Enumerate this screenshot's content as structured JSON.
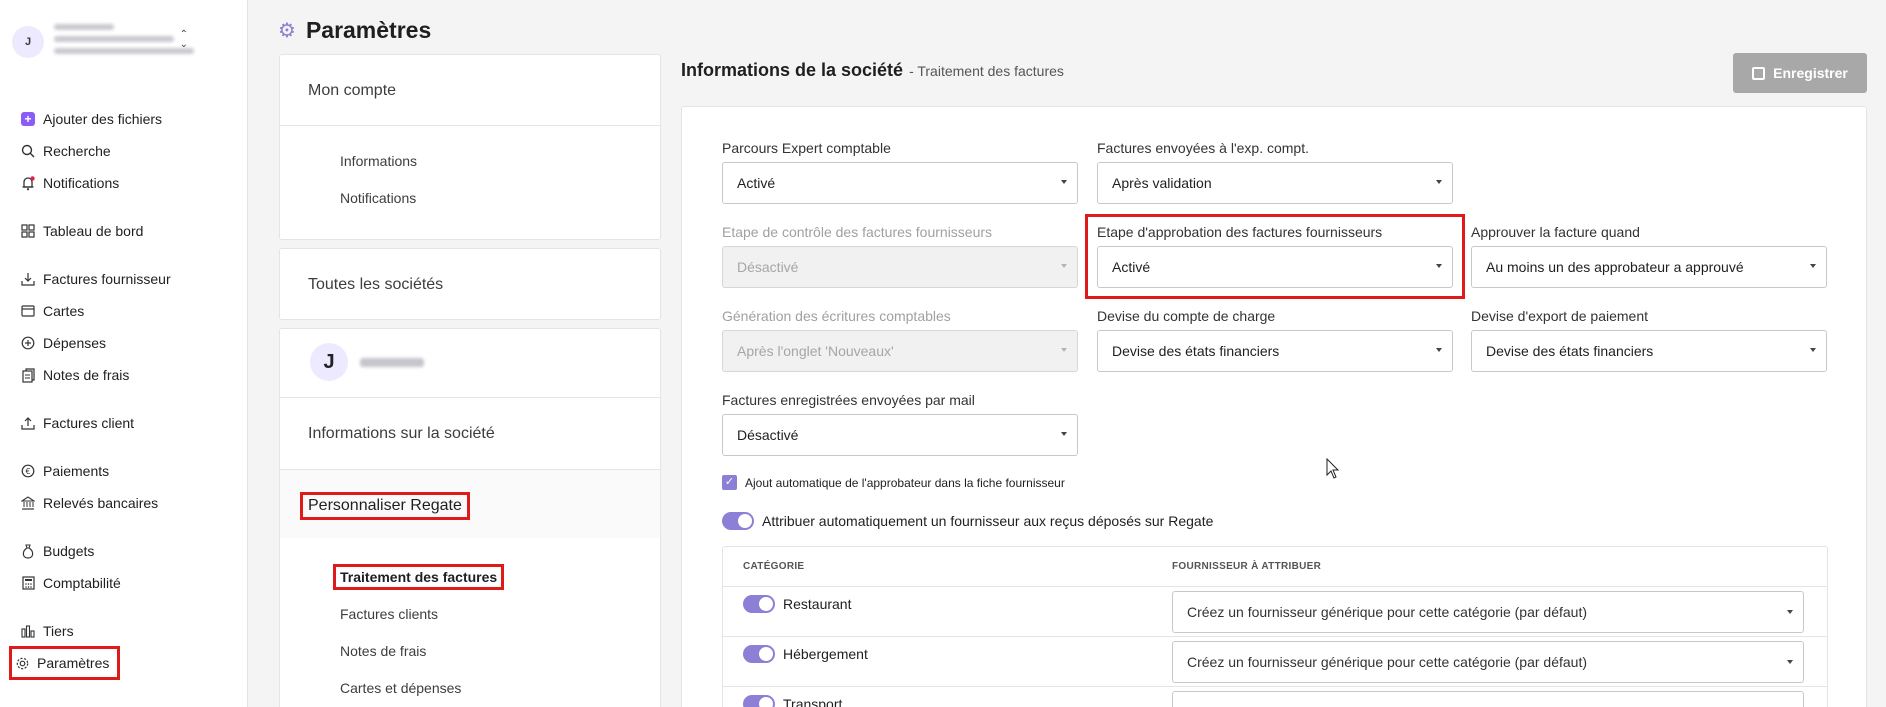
{
  "sidebar": {
    "user_initial": "J",
    "items": [
      {
        "label": "Ajouter des fichiers",
        "icon": "add-files-icon"
      },
      {
        "label": "Recherche",
        "icon": "search-icon"
      },
      {
        "label": "Notifications",
        "icon": "bell-icon"
      },
      {
        "label": "Tableau de bord",
        "icon": "dashboard-icon"
      },
      {
        "label": "Factures fournisseur",
        "icon": "inbox-download-icon"
      },
      {
        "label": "Cartes",
        "icon": "card-icon"
      },
      {
        "label": "Dépenses",
        "icon": "plus-circle-icon"
      },
      {
        "label": "Notes de frais",
        "icon": "receipt-icon"
      },
      {
        "label": "Factures client",
        "icon": "upload-icon"
      },
      {
        "label": "Paiements",
        "icon": "euro-icon"
      },
      {
        "label": "Relevés bancaires",
        "icon": "bank-icon"
      },
      {
        "label": "Budgets",
        "icon": "money-bag-icon"
      },
      {
        "label": "Comptabilité",
        "icon": "calculator-icon"
      },
      {
        "label": "Tiers",
        "icon": "bars-icon"
      },
      {
        "label": "Paramètres",
        "icon": "gear-icon"
      }
    ]
  },
  "header": {
    "title": "Paramètres"
  },
  "settings_nav": {
    "mon_compte": "Mon compte",
    "informations": "Informations",
    "notifications": "Notifications",
    "toutes_societes": "Toutes les sociétés",
    "company_initial": "J",
    "infos_societe": "Informations sur la société",
    "personnaliser": "Personnaliser Regate",
    "traitement": "Traitement des factures",
    "factures_clients": "Factures clients",
    "notes_frais": "Notes de frais",
    "cartes_depenses": "Cartes et dépenses"
  },
  "content": {
    "title": "Informations de la société",
    "subtitle": "- Traitement des factures",
    "save_label": "Enregistrer"
  },
  "fields": {
    "parcours": {
      "label": "Parcours Expert comptable",
      "value": "Activé"
    },
    "factures_envoyees": {
      "label": "Factures envoyées à l'exp. compt.",
      "value": "Après validation"
    },
    "etape_controle": {
      "label": "Etape de contrôle des factures fournisseurs",
      "value": "Désactivé"
    },
    "etape_approbation": {
      "label": "Etape d'approbation des factures fournisseurs",
      "value": "Activé"
    },
    "approuver_quand": {
      "label": "Approuver la facture quand",
      "value": "Au moins un des approbateur a approuvé"
    },
    "generation": {
      "label": "Génération des écritures comptables",
      "value": "Après l'onglet 'Nouveaux'"
    },
    "devise_charge": {
      "label": "Devise du compte de charge",
      "value": "Devise des états financiers"
    },
    "devise_export": {
      "label": "Devise d'export de paiement",
      "value": "Devise des états financiers"
    },
    "factures_mail": {
      "label": "Factures enregistrées envoyées par mail",
      "value": "Désactivé"
    }
  },
  "options": {
    "ajout_auto": "Ajout automatique de l'approbateur dans la fiche fournisseur",
    "attribuer_auto": "Attribuer automatiquement un fournisseur aux reçus déposés sur Regate"
  },
  "table": {
    "col_categorie": "CATÉGORIE",
    "col_fournisseur": "FOURNISSEUR À ATTRIBUER",
    "rows": [
      {
        "name": "Restaurant",
        "value": "Créez un fournisseur générique pour cette catégorie (par défaut)"
      },
      {
        "name": "Hébergement",
        "value": "Créez un fournisseur générique pour cette catégorie (par défaut)"
      },
      {
        "name": "Transport",
        "value": ""
      }
    ]
  }
}
